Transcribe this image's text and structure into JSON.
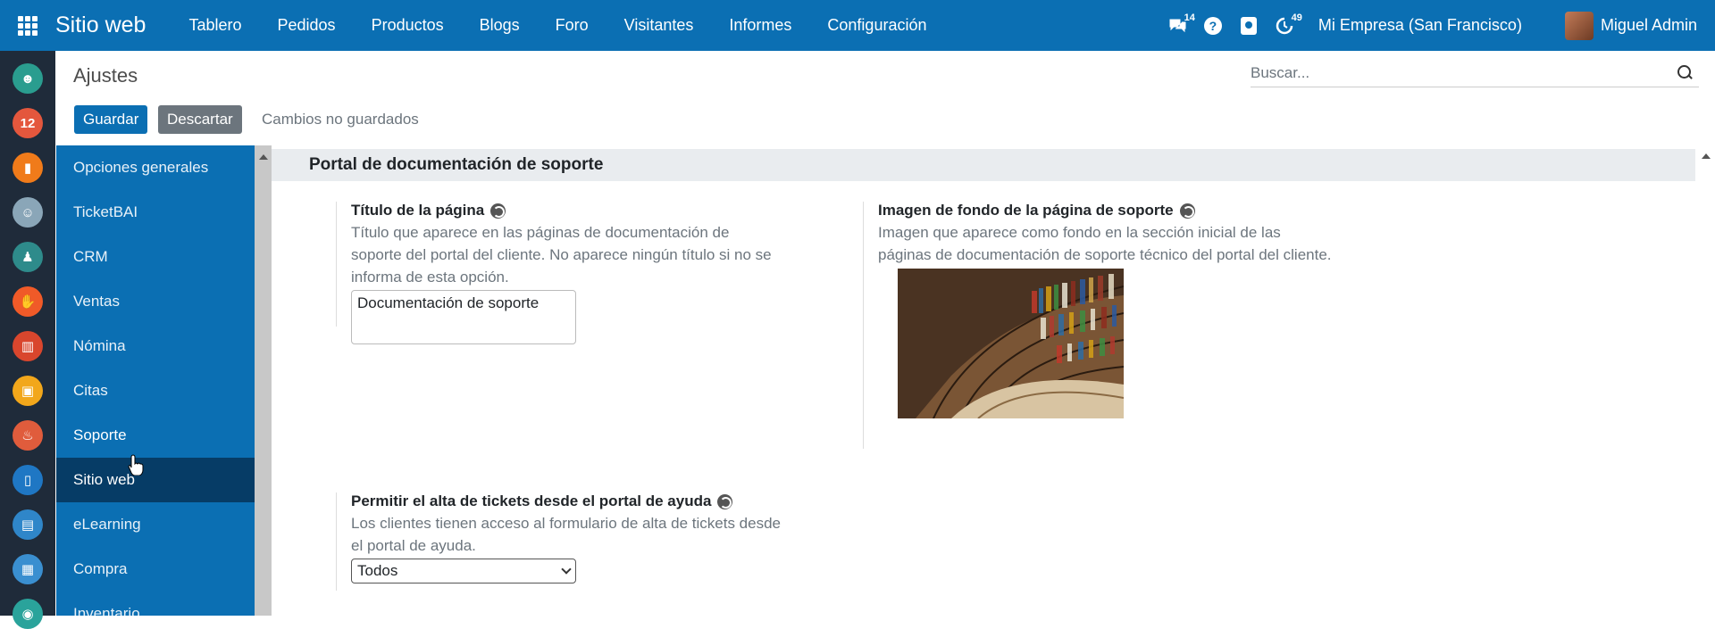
{
  "topbar": {
    "brand": "Sitio web",
    "menu": [
      "Tablero",
      "Pedidos",
      "Productos",
      "Blogs",
      "Foro",
      "Visitantes",
      "Informes",
      "Configuración"
    ],
    "messages_badge": "14",
    "activities_badge": "49",
    "company": "Mi Empresa (San Francisco)",
    "user": "Miguel Admin"
  },
  "control_panel": {
    "title": "Ajustes",
    "search_placeholder": "Buscar...",
    "save_label": "Guardar",
    "discard_label": "Descartar",
    "unsaved_text": "Cambios no guardados"
  },
  "sidebar": {
    "items": [
      "Opciones generales",
      "TicketBAI",
      "CRM",
      "Ventas",
      "Nómina",
      "Citas",
      "Soporte",
      "Sitio web",
      "eLearning",
      "Compra",
      "Inventario"
    ],
    "active": "Sitio web"
  },
  "section": {
    "title": "Portal de documentación de soporte",
    "page_title": {
      "label": "Título de la página",
      "description": "Título que aparece en las páginas de documentación de soporte del portal del cliente. No aparece ningún título si no se informa de esta opción.",
      "value": "Documentación de soporte"
    },
    "background_image": {
      "label": "Imagen de fondo de la página de soporte",
      "description": "Imagen que aparece como fondo en la sección inicial de las páginas de documentación de soporte técnico del portal del cliente."
    },
    "ticket_creation": {
      "label": "Permitir el alta de tickets desde el portal de ayuda",
      "description": "Los clientes tienen acceso al formulario de alta de tickets desde el portal de ayuda.",
      "selected": "Todos"
    }
  },
  "colors": {
    "primary": "#0b6fb3",
    "active_sidebar": "#063c66",
    "app_strip": "#1f2b3a"
  }
}
